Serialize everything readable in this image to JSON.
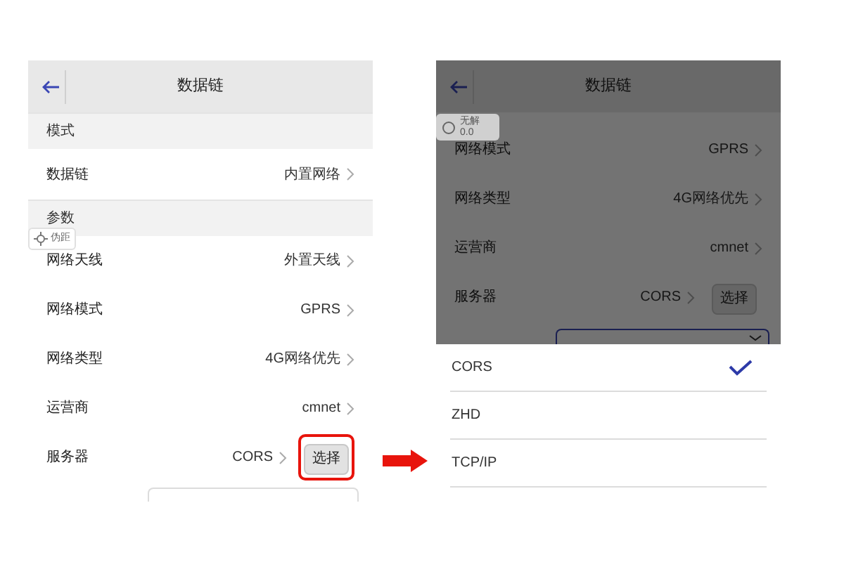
{
  "left_screen": {
    "title": "数据链",
    "badge": {
      "label": "伪距"
    },
    "sections": [
      {
        "header": "模式",
        "rows": [
          {
            "label": "数据链",
            "value": "内置网络"
          }
        ]
      },
      {
        "header": "参数",
        "rows": [
          {
            "label": "网络天线",
            "value": "外置天线"
          },
          {
            "label": "网络模式",
            "value": "GPRS"
          },
          {
            "label": "网络类型",
            "value": "4G网络优先"
          },
          {
            "label": "运营商",
            "value": "cmnet"
          },
          {
            "label": "服务器",
            "value": "CORS",
            "button": {
              "label": "选择",
              "highlighted": true
            }
          }
        ]
      }
    ]
  },
  "right_screen": {
    "title": "数据链",
    "badge": {
      "status": "无解",
      "reading": "0.0"
    },
    "rows": [
      {
        "label": "网络模式",
        "value": "GPRS"
      },
      {
        "label": "网络类型",
        "value": "4G网络优先"
      },
      {
        "label": "运营商",
        "value": "cmnet"
      },
      {
        "label": "服务器",
        "value": "CORS",
        "button": {
          "label": "选择",
          "highlighted": false
        }
      }
    ],
    "options": [
      {
        "label": "CORS",
        "selected": true
      },
      {
        "label": "ZHD",
        "selected": false
      },
      {
        "label": "TCP/IP",
        "selected": false
      }
    ]
  }
}
